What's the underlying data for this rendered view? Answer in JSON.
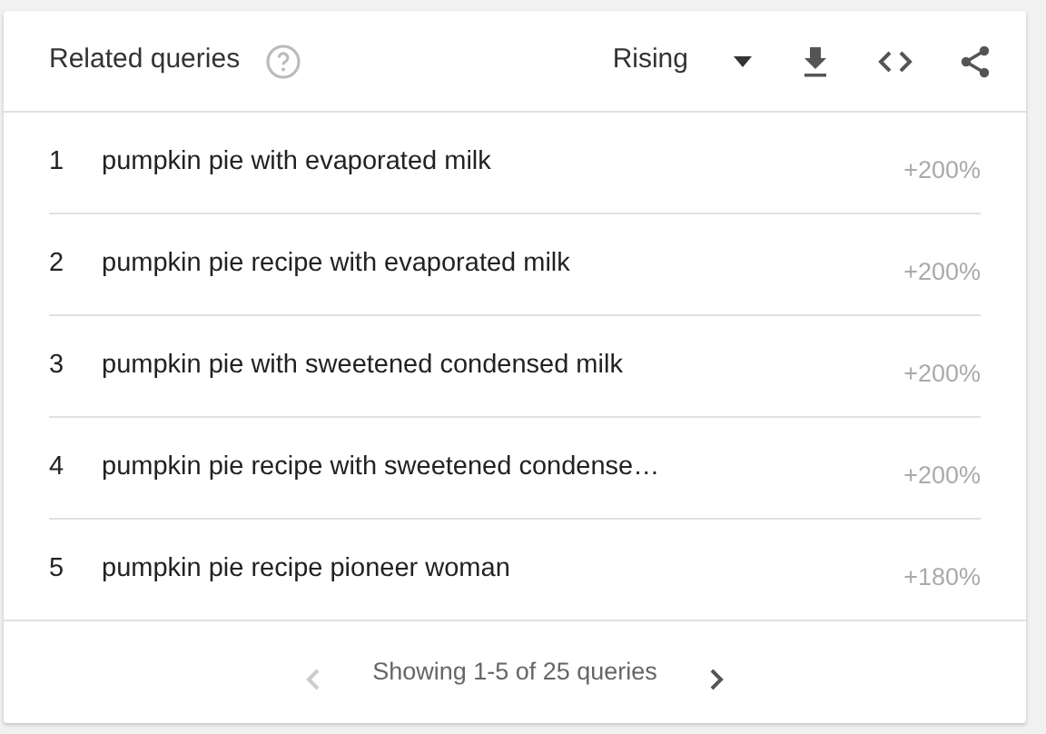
{
  "title": "Related queries",
  "filter": {
    "label": "Rising"
  },
  "rows": [
    {
      "rank": "1",
      "query": "pumpkin pie with evaporated milk",
      "value": "+200%"
    },
    {
      "rank": "2",
      "query": "pumpkin pie recipe with evaporated milk",
      "value": "+200%"
    },
    {
      "rank": "3",
      "query": "pumpkin pie with sweetened condensed milk",
      "value": "+200%"
    },
    {
      "rank": "4",
      "query": "pumpkin pie recipe with sweetened condense…",
      "value": "+200%"
    },
    {
      "rank": "5",
      "query": "pumpkin pie recipe pioneer woman",
      "value": "+180%"
    }
  ],
  "pager": {
    "text": "Showing 1-5 of 25 queries",
    "prev_disabled": true,
    "next_disabled": false
  }
}
